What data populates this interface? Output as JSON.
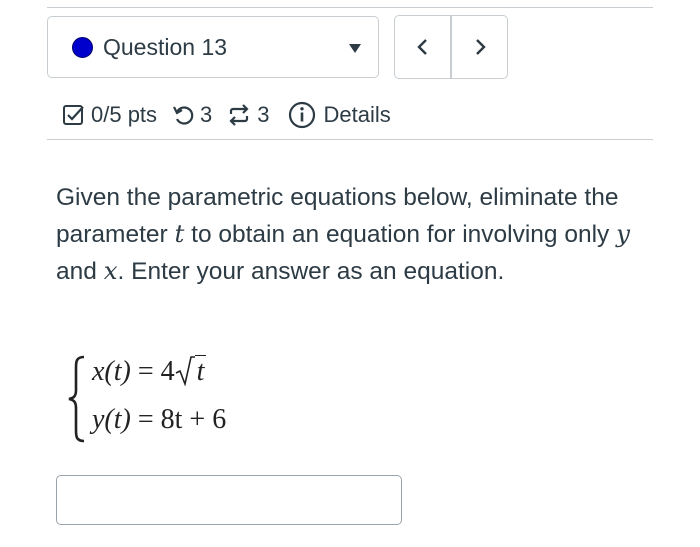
{
  "question_nav": {
    "label": "Question 13",
    "dot_color": "#0000cc",
    "prev_icon": "chevron-left-icon",
    "next_icon": "chevron-right-icon"
  },
  "meta": {
    "score": "0/5 pts",
    "attempts": "3",
    "resubmissions": "3",
    "details_label": "Details"
  },
  "question": {
    "text_1": "Given the parametric equations below, eliminate the parameter ",
    "var_t": "t",
    "text_2": " to obtain an equation for involving only ",
    "var_y": "y",
    "text_3": " and ",
    "var_x": "x",
    "text_4": ".  Enter your answer as an equation."
  },
  "equations": {
    "eq1_lhs": "x(t)",
    "eq1_rhs_coef": "4",
    "eq1_rhs_radicand": "t",
    "eq2_lhs": "y(t)",
    "eq2_rhs": "8t + 6"
  },
  "answer": {
    "value": ""
  }
}
